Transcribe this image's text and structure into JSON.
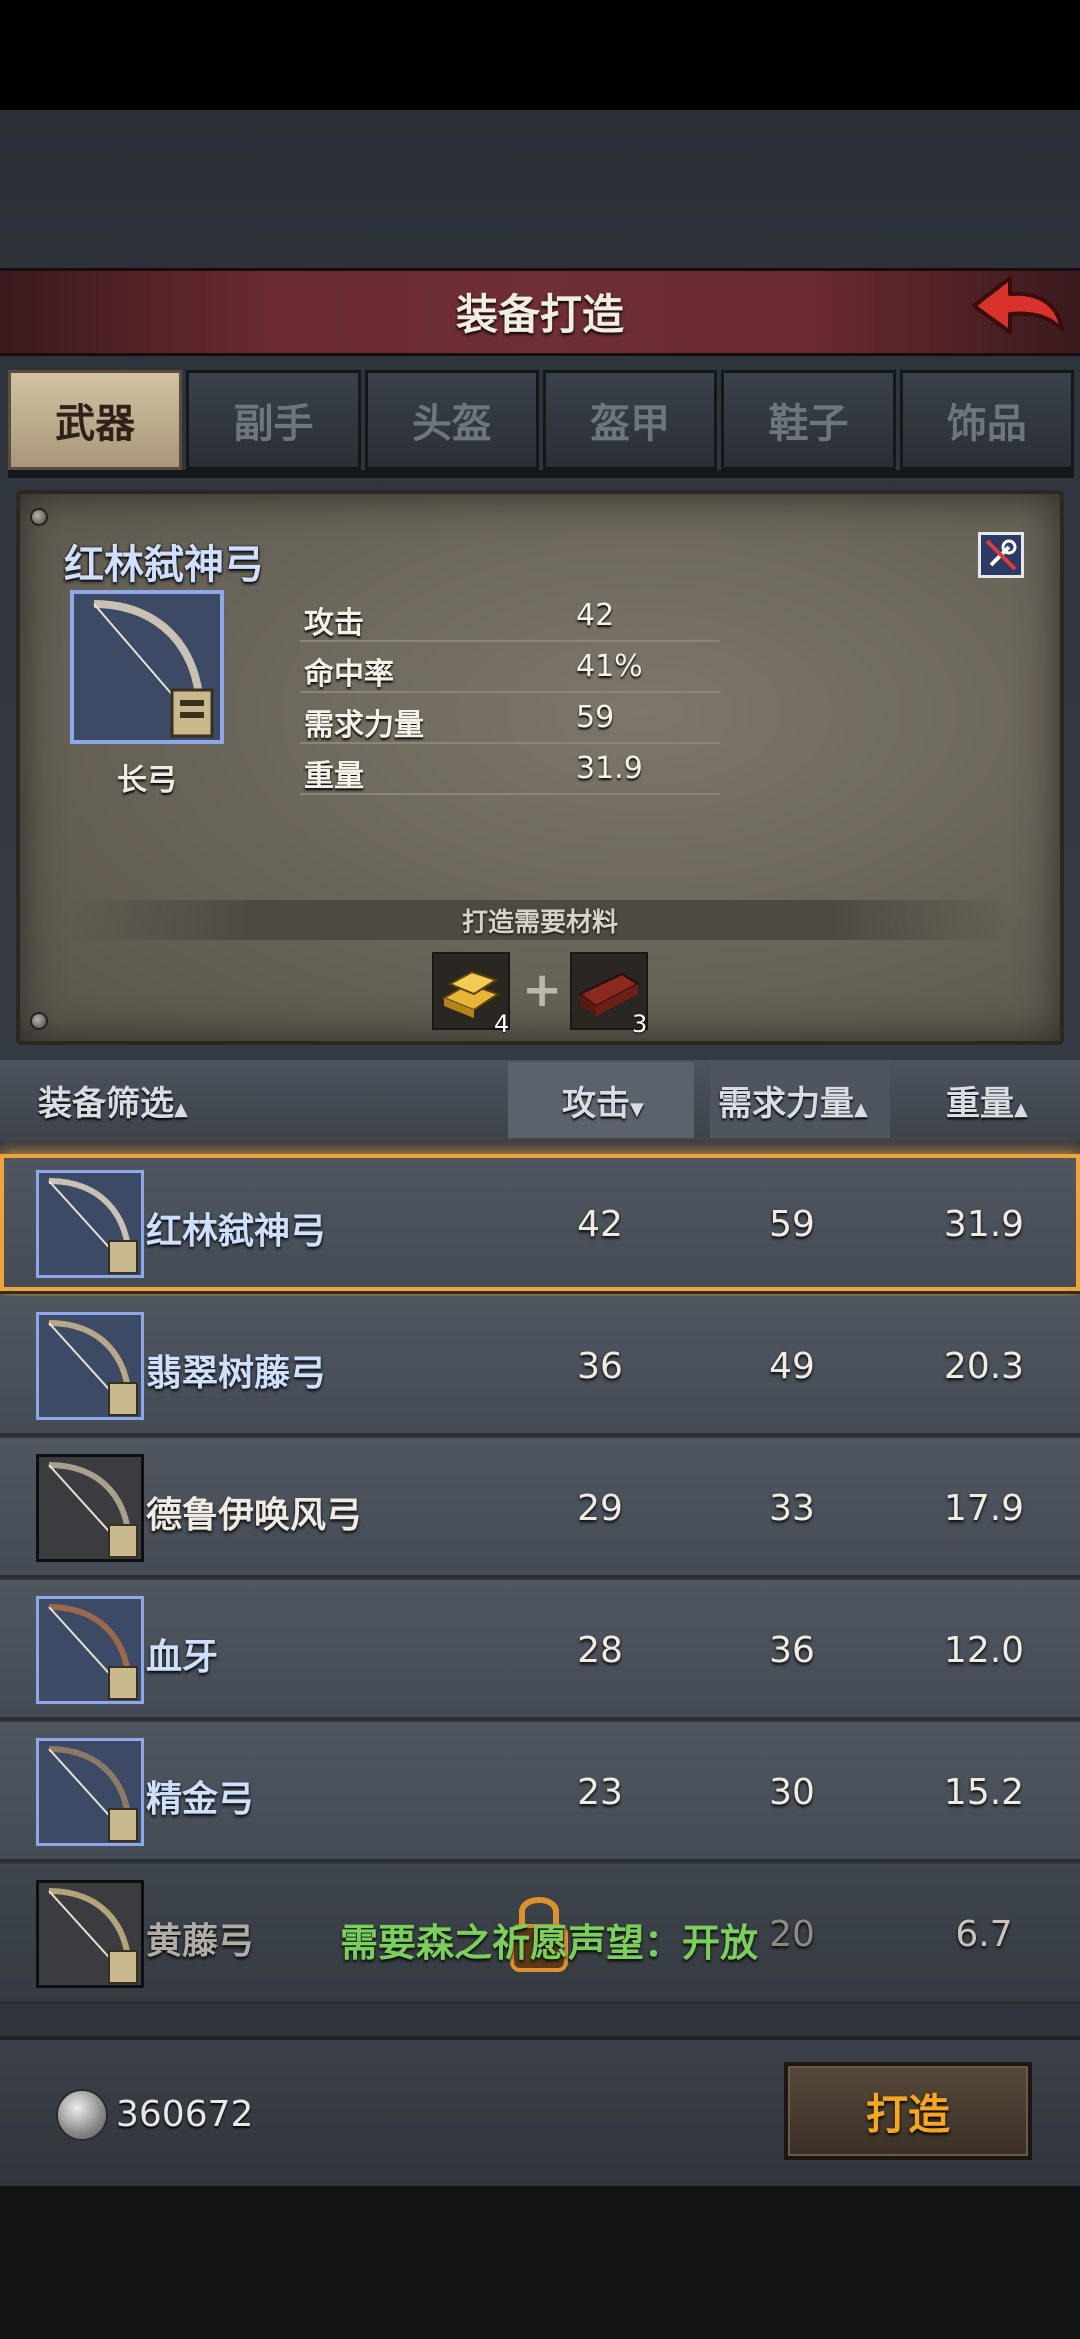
{
  "header": {
    "title": "装备打造"
  },
  "tabs": [
    {
      "label": "武器",
      "active": true
    },
    {
      "label": "副手",
      "active": false
    },
    {
      "label": "头盔",
      "active": false
    },
    {
      "label": "盔甲",
      "active": false
    },
    {
      "label": "鞋子",
      "active": false
    },
    {
      "label": "饰品",
      "active": false
    }
  ],
  "detail": {
    "name": "红林弑神弓",
    "type": "长弓",
    "stats": [
      {
        "label": "攻击",
        "value": "42"
      },
      {
        "label": "命中率",
        "value": "41%"
      },
      {
        "label": "需求力量",
        "value": "59"
      },
      {
        "label": "重量",
        "value": "31.9"
      }
    ],
    "materials_title": "打造需要材料",
    "materials": [
      {
        "icon": "gold-ingot-icon",
        "count": "4"
      },
      {
        "icon": "wood-plank-icon",
        "count": "3"
      }
    ]
  },
  "list_header": {
    "filter": "装备筛选",
    "attack": "攻击",
    "strength": "需求力量",
    "weight": "重量"
  },
  "items": [
    {
      "name": "红林弑神弓",
      "attack": "42",
      "strength": "59",
      "weight": "31.9",
      "rarity": "blue"
    },
    {
      "name": "翡翠树藤弓",
      "attack": "36",
      "strength": "49",
      "weight": "20.3",
      "rarity": "blue"
    },
    {
      "name": "德鲁伊唤风弓",
      "attack": "29",
      "strength": "33",
      "weight": "17.9",
      "rarity": "white"
    },
    {
      "name": "血牙",
      "attack": "28",
      "strength": "36",
      "weight": "12.0",
      "rarity": "blue"
    },
    {
      "name": "精金弓",
      "attack": "23",
      "strength": "30",
      "weight": "15.2",
      "rarity": "blue"
    },
    {
      "name": "黄藤弓",
      "attack": "",
      "strength": "20",
      "weight": "6.7",
      "rarity": "white",
      "locked": true,
      "requirement": "需要森之祈愿声望：开放"
    }
  ],
  "footer": {
    "currency": "360672",
    "craft_label": "打造"
  },
  "colors": {
    "header_red": "#6a2a30",
    "blue_name": "#cfe0ff",
    "selection": "#f0a33a",
    "requirement_green": "#7ad05a",
    "craft_text": "#f5a623"
  }
}
